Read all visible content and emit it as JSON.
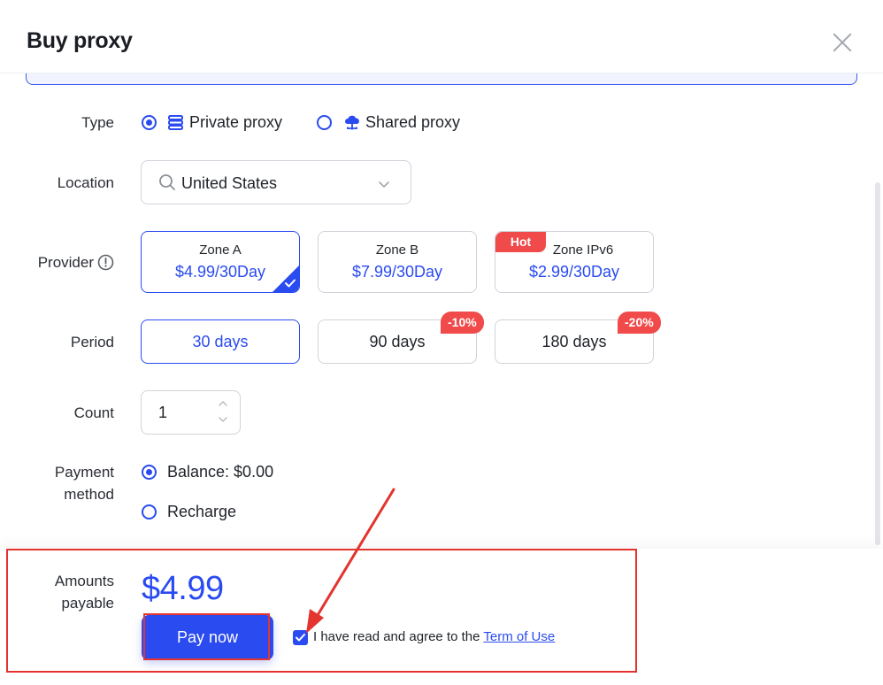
{
  "dialog": {
    "title": "Buy proxy"
  },
  "form": {
    "type_label": "Type",
    "type_options": [
      {
        "label": "Private proxy",
        "icon": "server-stack-icon",
        "checked": true
      },
      {
        "label": "Shared proxy",
        "icon": "cloud-network-icon",
        "checked": false
      }
    ],
    "location_label": "Location",
    "location_value": "United States",
    "provider_label": "Provider",
    "providers": [
      {
        "name": "Zone A",
        "price": "$4.99/30Day",
        "selected": true,
        "badge": ""
      },
      {
        "name": "Zone B",
        "price": "$7.99/30Day",
        "selected": false,
        "badge": ""
      },
      {
        "name": "Zone IPv6",
        "price": "$2.99/30Day",
        "selected": false,
        "badge": "Hot"
      }
    ],
    "period_label": "Period",
    "periods": [
      {
        "label": "30 days",
        "selected": true,
        "discount": ""
      },
      {
        "label": "90 days",
        "selected": false,
        "discount": "-10%"
      },
      {
        "label": "180 days",
        "selected": false,
        "discount": "-20%"
      }
    ],
    "count_label": "Count",
    "count_value": "1",
    "payment_label_line1": "Payment",
    "payment_label_line2": "method",
    "payment_options": [
      {
        "label": "Balance: $0.00",
        "checked": true
      },
      {
        "label": "Recharge",
        "checked": false
      }
    ]
  },
  "footer": {
    "amount_label_line1": "Amounts",
    "amount_label_line2": "payable",
    "amount_value": "$4.99",
    "pay_button": "Pay now",
    "agree_text": "I have read and agree to the ",
    "terms_link": "Term of Use",
    "agree_checked": true
  },
  "colors": {
    "accent": "#2a4bf0",
    "badge_red": "#f04a4a",
    "annotation_red": "#e3342f"
  }
}
